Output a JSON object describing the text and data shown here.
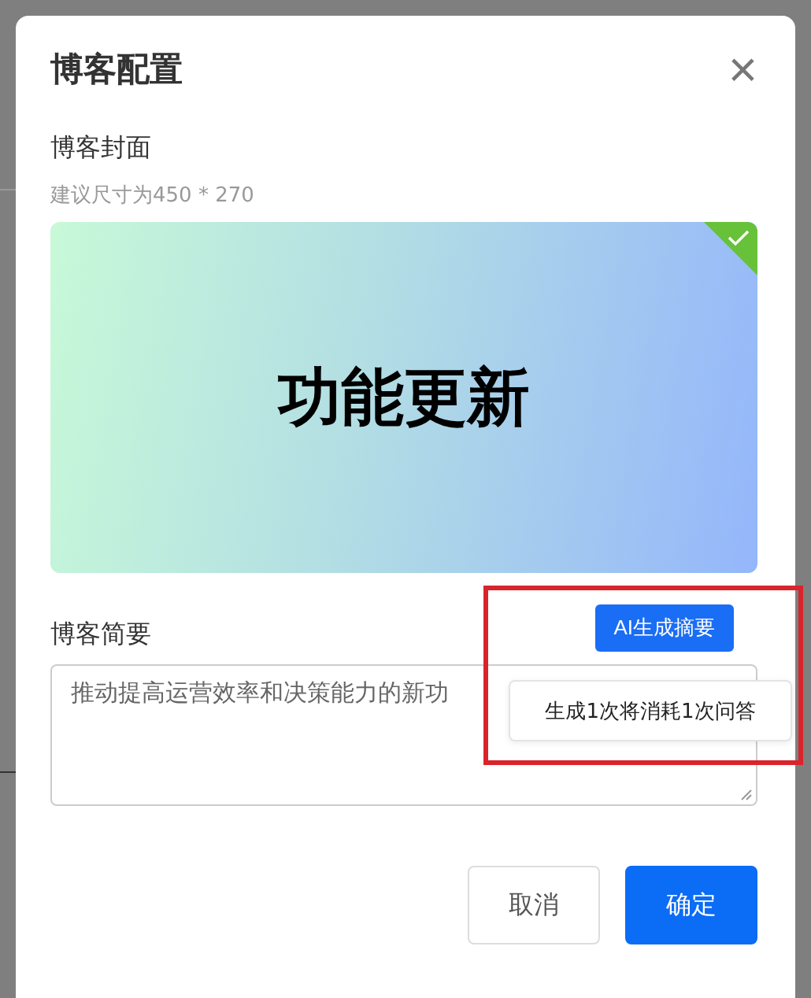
{
  "dialog": {
    "title": "博客配置",
    "close_icon": "×"
  },
  "cover": {
    "label": "博客封面",
    "hint": "建议尺寸为450 * 270",
    "image_text": "功能更新",
    "uploaded": true
  },
  "summary": {
    "label": "博客简要",
    "ai_button": "AI生成摘要",
    "value": "推动提高运营效率和决策能力的新功",
    "tooltip": "生成1次将消耗1次问答"
  },
  "annotation": {
    "highlighted": true
  },
  "buttons": [
    {
      "label": "取消",
      "kind": "secondary"
    },
    {
      "label": "确定",
      "kind": "primary"
    }
  ]
}
